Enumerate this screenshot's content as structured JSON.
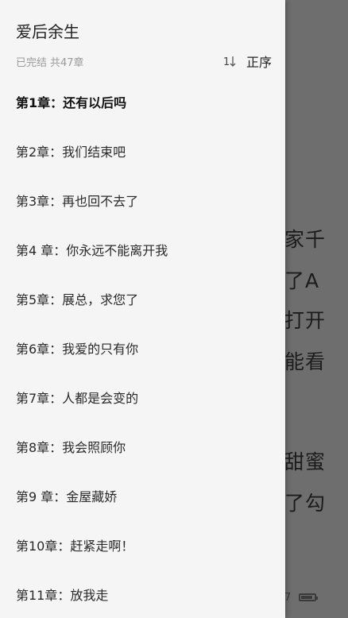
{
  "book": {
    "title": "爱后余生",
    "status": "已完结",
    "count": "共47章"
  },
  "sort": {
    "label": "正序",
    "icon": "sort-ascending-icon"
  },
  "chapters": [
    {
      "title": "第1章：还有以后吗",
      "current": true
    },
    {
      "title": "第2章：我们结束吧"
    },
    {
      "title": "第3章：再也回不去了"
    },
    {
      "title": "第4 章：你永远不能离开我"
    },
    {
      "title": "第5章：展总，求您了"
    },
    {
      "title": "第6章：我爱的只有你"
    },
    {
      "title": "第7章：人都是会变的"
    },
    {
      "title": "第8章：我会照顾你"
    },
    {
      "title": "第9 章：金屋藏娇"
    },
    {
      "title": "第10章：赶紧走啊！"
    },
    {
      "title": "第11章：放我走"
    }
  ],
  "reader": {
    "lines": [
      "家千",
      "了A",
      "打开",
      "能看",
      "甜蜜",
      "了勾"
    ],
    "status_time": "7",
    "battery_level": 0.85
  },
  "colors": {
    "drawer_bg": "#f5f5f5",
    "overlay": "#6e6e6e",
    "text_primary": "#222222",
    "text_secondary": "#9a9a9a"
  }
}
